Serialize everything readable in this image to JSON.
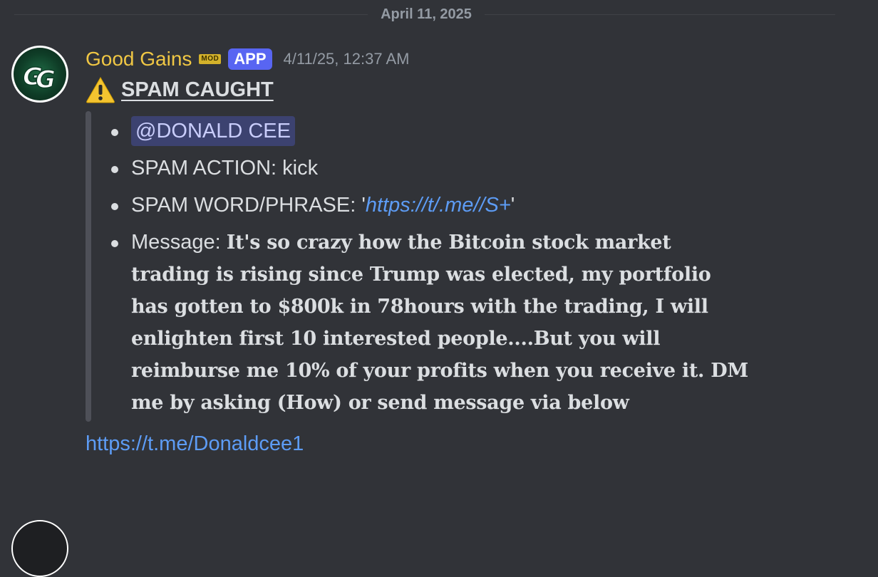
{
  "date_divider": {
    "label": "April 11, 2025"
  },
  "message": {
    "author": {
      "name": "Good Gains",
      "name_color": "#f0c744",
      "avatar_icon": "good-gains-logo-icon",
      "avatar_initials": "GG",
      "mod_badge": "MOD",
      "app_badge": "APP"
    },
    "timestamp": "4/11/25, 12:37 AM",
    "title": {
      "icon": "warning-icon",
      "text": "SPAM CAUGHT"
    },
    "items": {
      "mention": "@DONALD CEE",
      "action_label": "SPAM ACTION: ",
      "action_value": "kick",
      "phrase_label": "SPAM WORD/PHRASE: ",
      "phrase_quote_open": "'",
      "phrase_value": "https://t/.me//S+",
      "phrase_quote_close": "'",
      "message_label": "Message: ",
      "message_body": "It's so crazy how the Bitcoin stock market trading is rising since Trump was elected, my portfolio has gotten to $800k  in 78hours with the trading, I will enlighten first 10 interested people....But you will reimburse me 10% of your profits when you receive it. DM me by asking (How) or send message via below"
    },
    "link": "https://t.me/Donaldcee1"
  },
  "colors": {
    "background": "#313338",
    "link": "#5d9cf5",
    "app_badge": "#5865f2",
    "mention_bg": "#3c4270"
  }
}
